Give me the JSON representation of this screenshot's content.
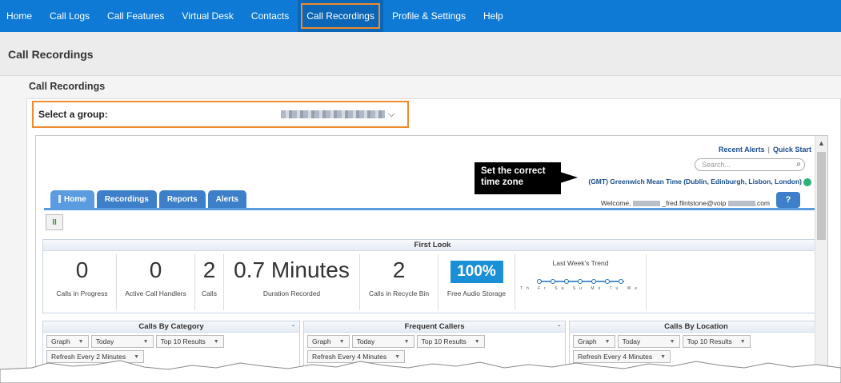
{
  "nav": {
    "items": [
      {
        "label": "Home",
        "active": false
      },
      {
        "label": "Call Logs",
        "active": false
      },
      {
        "label": "Call Features",
        "active": false
      },
      {
        "label": "Virtual Desk",
        "active": false
      },
      {
        "label": "Contacts",
        "active": false
      },
      {
        "label": "Call Recordings",
        "active": true
      },
      {
        "label": "Profile & Settings",
        "active": false
      },
      {
        "label": "Help",
        "active": false
      }
    ],
    "color": "#0f7ad6",
    "highlight_color": "#f08a2a"
  },
  "page": {
    "title": "Call Recordings",
    "section_title": "Call Recordings"
  },
  "group_select": {
    "label": "Select a group:",
    "chevron": "chevron-down-icon"
  },
  "app": {
    "links": {
      "recent_alerts": "Recent Alerts",
      "separator": "|",
      "quick_start": "Quick Start"
    },
    "search_placeholder": "Search...",
    "timezone": "(GMT) Greenwich Mean Time (Dublin, Edinburgh, Lisbon, London)",
    "callout": "Set the correct time zone",
    "welcome_prefix": "Welcome,",
    "welcome_email": "_fred.flintstone@voip",
    "welcome_suffix": ".com",
    "tabs": [
      {
        "label": "Home",
        "active": true
      },
      {
        "label": "Recordings",
        "active": false
      },
      {
        "label": "Reports",
        "active": false
      },
      {
        "label": "Alerts",
        "active": false
      }
    ],
    "help_icon": "?",
    "pause_icon": "II"
  },
  "first_look": {
    "title": "First Look",
    "stats": [
      {
        "value": "0",
        "label": "Calls in Progress"
      },
      {
        "value": "0",
        "label": "Active Call Handlers"
      },
      {
        "value": "2",
        "label": "Calls"
      },
      {
        "value": "0.7 Minutes",
        "label": "Duration Recorded"
      },
      {
        "value": "2",
        "label": "Calls in Recycle Bin"
      }
    ],
    "storage": {
      "value": "100%",
      "label": "Free Audio Storage"
    },
    "trend": {
      "title": "Last Week's Trend",
      "days": [
        "Th",
        "Fr",
        "Sa",
        "Su",
        "Mo",
        "Tu",
        "We"
      ]
    }
  },
  "widgets": [
    {
      "title": "Calls By Category",
      "view": "Graph",
      "period": "Today",
      "limit": "Top 10 Results",
      "refresh": "Refresh Every 2 Minutes"
    },
    {
      "title": "Frequent Callers",
      "view": "Graph",
      "period": "Today",
      "limit": "Top 10 Results",
      "refresh": "Refresh Every 4 Minutes"
    },
    {
      "title": "Calls By Location",
      "view": "Graph",
      "period": "Today",
      "limit": "Top 10 Results",
      "refresh": "Refresh Every 4 Minutes"
    }
  ]
}
